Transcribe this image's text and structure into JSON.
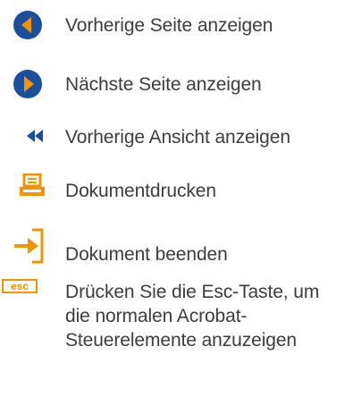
{
  "colors": {
    "accent": "#f29400",
    "circle": "#1a4f9c",
    "text": "#3d3d3d"
  },
  "items": [
    {
      "icon": "previous-page-icon",
      "label": "Vorherige Seite anzeigen"
    },
    {
      "icon": "next-page-icon",
      "label": "Nächste Seite anzeigen"
    },
    {
      "icon": "previous-view-icon",
      "label": "Vorherige Ansicht anzeigen"
    },
    {
      "icon": "print-icon",
      "label": "Dokumentdrucken"
    },
    {
      "icon": "exit-document-icon",
      "label": "Dokument beenden"
    },
    {
      "icon": "esc-key-icon",
      "key": "esc",
      "label": "Drücken Sie die Esc-Taste, um die normalen Acrobat-Steuerelemente anzuzeigen"
    }
  ]
}
